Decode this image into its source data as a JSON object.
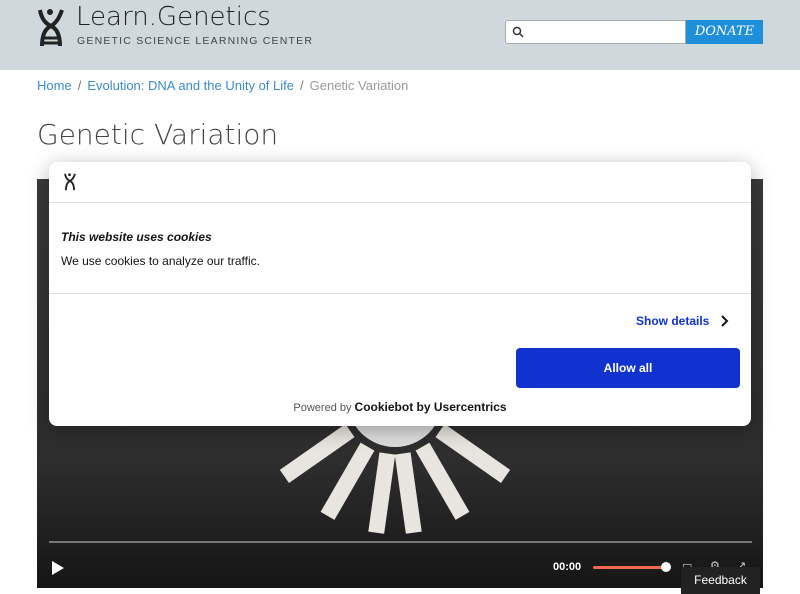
{
  "header": {
    "logo_title": "Learn.Genetics",
    "logo_subtitle": "GENETIC SCIENCE LEARNING CENTER",
    "search_placeholder": "",
    "donate_label": "DONATE"
  },
  "breadcrumb": {
    "items": [
      "Home",
      "Evolution: DNA and the Unity of Life"
    ],
    "current": "Genetic Variation",
    "separator": "/"
  },
  "page": {
    "title": "Genetic Variation"
  },
  "video": {
    "time": "00:00",
    "volume_percent": 100,
    "progress_percent": 0
  },
  "cookie_banner": {
    "title": "This website uses cookies",
    "text": "We use cookies to analyze our traffic.",
    "show_details": "Show details",
    "allow_all": "Allow all",
    "powered_by": "Powered by",
    "brand": "Cookiebot by Usercentrics"
  },
  "feedback": {
    "label": "Feedback"
  },
  "colors": {
    "header_bg": "#cfd8dc",
    "donate": "#1e8fd8",
    "cookie_blue": "#1032cf",
    "volume": "#f0684d"
  }
}
